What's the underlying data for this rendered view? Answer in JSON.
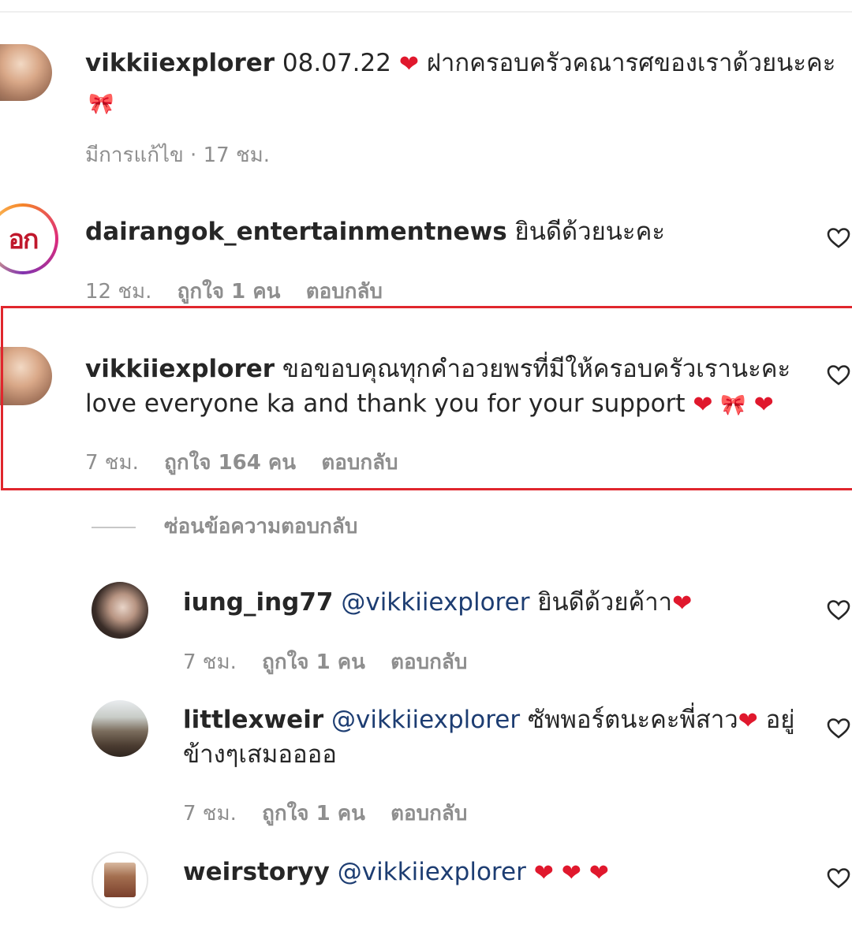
{
  "comments": [
    {
      "username": "vikkiiexplorer",
      "text": "08.07.22",
      "text_after_heart": "ฝากครอบครัวคณารศของเราด้วยนะคะ",
      "meta": {
        "time": "มีการแก้ไข · 17 ชม."
      }
    },
    {
      "username": "dairangok_entertainmentnews",
      "text": "ยินดีด้วยนะคะ",
      "avatar_text": "อก",
      "meta": {
        "time": "12 ชม.",
        "likes": "ถูกใจ 1 คน",
        "reply": "ตอบกลับ"
      }
    },
    {
      "username": "vikkiiexplorer",
      "text": "ขอขอบคุณทุกคำอวยพรที่มีให้ครอบครัวเรานะคะ",
      "text_line2": "love everyone ka and thank you for your support",
      "meta": {
        "time": "7 ชม.",
        "likes": "ถูกใจ 164 คน",
        "reply": "ตอบกลับ"
      }
    }
  ],
  "hide_replies_label": "ซ่อนข้อความตอบกลับ",
  "replies": [
    {
      "username": "iung_ing77",
      "mention": "@vikkiiexplorer",
      "text": "ยินดีด้วยค้าา",
      "meta": {
        "time": "7 ชม.",
        "likes": "ถูกใจ 1 คน",
        "reply": "ตอบกลับ"
      }
    },
    {
      "username": "littlexweir",
      "mention": "@vikkiiexplorer",
      "text": "ซัพพอร์ตนะคะพี่สาว",
      "text_after_heart": "อยู่",
      "text_line2": "ข้างๆเสมออออ",
      "meta": {
        "time": "7 ชม.",
        "likes": "ถูกใจ 1 คน",
        "reply": "ตอบกลับ"
      }
    },
    {
      "username": "weirstoryy",
      "mention": "@vikkiiexplorer"
    }
  ],
  "icons": {
    "like": "heart-outline-icon",
    "emoji_heart": "red-heart-emoji",
    "emoji_bow": "ribbon-emoji"
  },
  "colors": {
    "username": "#262626",
    "meta": "#8e8e8e",
    "mention": "#1d3d72",
    "highlight": "#e0262d",
    "heart": "#e0182d"
  },
  "emoji": {
    "heart": "❤",
    "bow": "🎀"
  }
}
